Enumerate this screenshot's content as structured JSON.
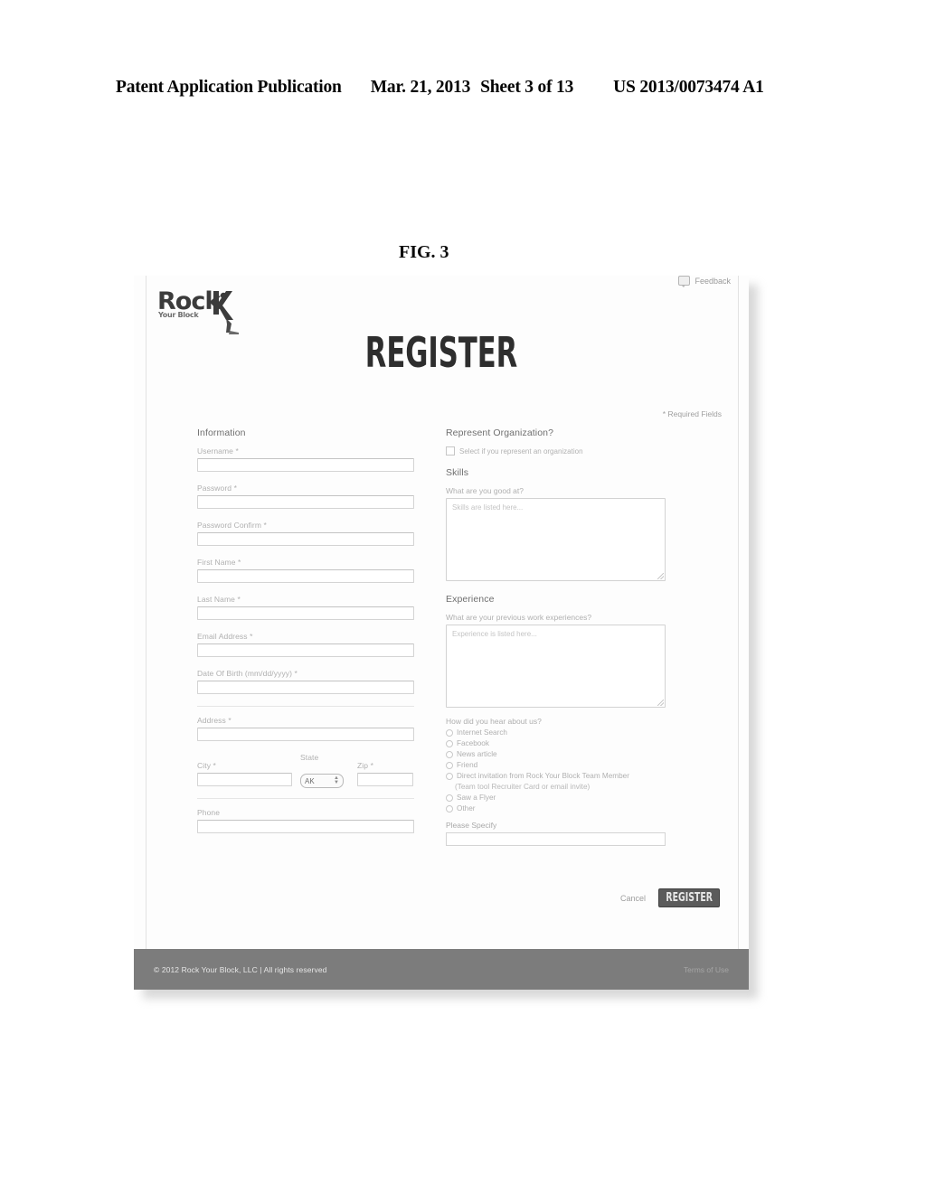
{
  "patent_header": {
    "publication": "Patent Application Publication",
    "date": "Mar. 21, 2013",
    "sheet": "Sheet 3 of 13",
    "number": "US 2013/0073474 A1"
  },
  "figure_label": "FIG. 3",
  "screenshot": {
    "logo": {
      "main": "Rock",
      "sub": "Your Block"
    },
    "feedback_label": "Feedback",
    "page_title": "REGISTER",
    "required_note": "* Required Fields",
    "left_column": {
      "section_heading": "Information",
      "fields": [
        {
          "label": "Username *",
          "value": ""
        },
        {
          "label": "Password *",
          "value": ""
        },
        {
          "label": "Password Confirm *",
          "value": ""
        },
        {
          "label": "First Name *",
          "value": ""
        },
        {
          "label": "Last Name *",
          "value": ""
        },
        {
          "label": "Email Address *",
          "value": ""
        },
        {
          "label": "Date Of Birth (mm/dd/yyyy) *",
          "value": ""
        },
        {
          "label": "Address *",
          "value": ""
        }
      ],
      "city_label": "City *",
      "city_value": "",
      "state_label": "State",
      "state_value": "AK",
      "zip_label": "Zip *",
      "zip_value": "",
      "phone_label": "Phone",
      "phone_value": ""
    },
    "right_column": {
      "organization": {
        "heading": "Represent Organization?",
        "checkbox_label": "Select if you represent an organization",
        "checked": false
      },
      "skills": {
        "heading": "Skills",
        "question": "What are you good at?",
        "placeholder": "Skills are listed here...",
        "value": ""
      },
      "experience": {
        "heading": "Experience",
        "question": "What are your previous work experiences?",
        "placeholder": "Experience is listed here...",
        "value": ""
      },
      "referral": {
        "question": "How did you hear about us?",
        "options": [
          "Internet Search",
          "Facebook",
          "News article",
          "Friend",
          "Direct invitation from Rock Your Block Team Member",
          "Saw a Flyer",
          "Other"
        ],
        "sub_note": "(Team tool Recruiter Card or email invite)",
        "specify_label": "Please Specify",
        "specify_value": ""
      }
    },
    "actions": {
      "cancel_label": "Cancel",
      "submit_label": "REGISTER"
    },
    "footer": {
      "copyright": "© 2012 Rock Your Block, LLC | All rights reserved",
      "terms": "Terms of Use"
    }
  }
}
